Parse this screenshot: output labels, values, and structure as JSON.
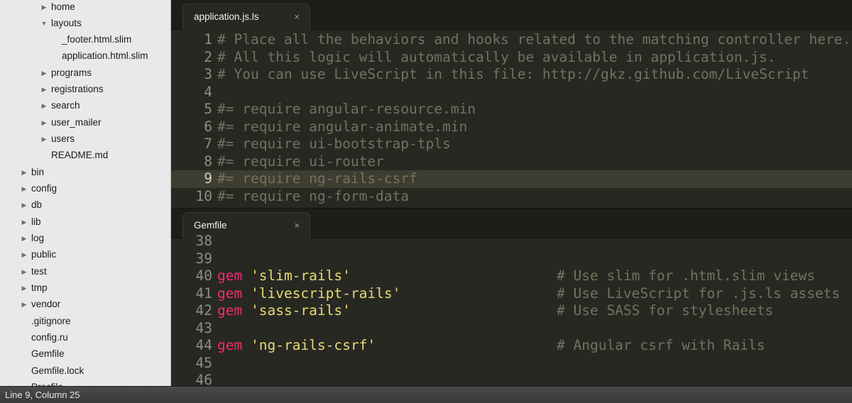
{
  "sidebar": {
    "items": [
      {
        "label": "home",
        "arrow": "▶"
      },
      {
        "label": "layouts",
        "arrow": "▼"
      },
      {
        "label": "_footer.html.slim",
        "arrow": ""
      },
      {
        "label": "application.html.slim",
        "arrow": ""
      },
      {
        "label": "programs",
        "arrow": "▶"
      },
      {
        "label": "registrations",
        "arrow": "▶"
      },
      {
        "label": "search",
        "arrow": "▶"
      },
      {
        "label": "user_mailer",
        "arrow": "▶"
      },
      {
        "label": "users",
        "arrow": "▶"
      },
      {
        "label": "README.md",
        "arrow": ""
      },
      {
        "label": "bin",
        "arrow": "▶"
      },
      {
        "label": "config",
        "arrow": "▶"
      },
      {
        "label": "db",
        "arrow": "▶"
      },
      {
        "label": "lib",
        "arrow": "▶"
      },
      {
        "label": "log",
        "arrow": "▶"
      },
      {
        "label": "public",
        "arrow": "▶"
      },
      {
        "label": "test",
        "arrow": "▶"
      },
      {
        "label": "tmp",
        "arrow": "▶"
      },
      {
        "label": "vendor",
        "arrow": "▶"
      },
      {
        "label": ".gitignore",
        "arrow": ""
      },
      {
        "label": "config.ru",
        "arrow": ""
      },
      {
        "label": "Gemfile",
        "arrow": ""
      },
      {
        "label": "Gemfile.lock",
        "arrow": ""
      },
      {
        "label": "Procfile",
        "arrow": ""
      }
    ]
  },
  "top_pane": {
    "tab": {
      "title": "application.js.ls",
      "close": "×"
    },
    "lines": [
      {
        "num": "1",
        "comment": "# Place all the behaviors and hooks related to the matching controller here."
      },
      {
        "num": "2",
        "comment": "# All this logic will automatically be available in application.js."
      },
      {
        "num": "3",
        "comment": "# You can use LiveScript in this file: http://gkz.github.com/LiveScript"
      },
      {
        "num": "4",
        "comment": ""
      },
      {
        "num": "5",
        "comment": "#= require angular-resource.min"
      },
      {
        "num": "6",
        "comment": "#= require angular-animate.min"
      },
      {
        "num": "7",
        "comment": "#= require ui-bootstrap-tpls"
      },
      {
        "num": "8",
        "comment": "#= require ui-router"
      },
      {
        "num": "9",
        "comment": "#= require ng-rails-csrf"
      },
      {
        "num": "10",
        "comment": "#= require ng-form-data"
      }
    ]
  },
  "bottom_pane": {
    "tab": {
      "title": "Gemfile",
      "close": "×"
    },
    "lines": [
      {
        "num": "38",
        "kw": "",
        "str": "",
        "comment": ""
      },
      {
        "num": "39",
        "kw": "",
        "str": "",
        "comment": ""
      },
      {
        "num": "40",
        "kw": "gem",
        "str": "'slim-rails'",
        "comment": "# Use slim for .html.slim views"
      },
      {
        "num": "41",
        "kw": "gem",
        "str": "'livescript-rails'",
        "comment": "# Use LiveScript for .js.ls assets"
      },
      {
        "num": "42",
        "kw": "gem",
        "str": "'sass-rails'",
        "comment": "# Use SASS for stylesheets"
      },
      {
        "num": "43",
        "kw": "",
        "str": "",
        "comment": ""
      },
      {
        "num": "44",
        "kw": "gem",
        "str": "'ng-rails-csrf'",
        "comment": "# Angular csrf with Rails"
      },
      {
        "num": "45",
        "kw": "",
        "str": "",
        "comment": ""
      },
      {
        "num": "46",
        "kw": "",
        "str": "",
        "comment": ""
      }
    ]
  },
  "statusbar": {
    "text": "Line 9, Column 25"
  },
  "colors": {
    "editor_bg": "#272822",
    "comment": "#75715e",
    "keyword": "#f92672",
    "string": "#e6db74",
    "sidebar_bg": "#e9e9e9"
  }
}
